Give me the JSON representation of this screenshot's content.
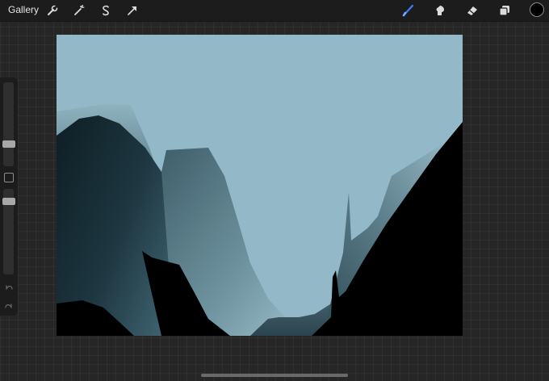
{
  "header": {
    "gallery_label": "Gallery",
    "left_tools": [
      "wrench-icon",
      "magic-wand-icon",
      "selection-icon",
      "transform-arrow-icon"
    ],
    "right_tools": [
      "brush-icon",
      "smudge-icon",
      "eraser-icon",
      "layers-icon"
    ],
    "active_tool": "brush",
    "accent_color": "#3b7ff0",
    "current_color": "#000000"
  },
  "canvas": {
    "sky_color": "#93b9c8",
    "foreground_color": "#000000",
    "haze_color": "#a7c6d2",
    "mountain_dark_color": "#14262d"
  },
  "sidebar": {
    "controls": [
      "brush-size-slider",
      "modify-button",
      "opacity-slider",
      "undo-icon",
      "redo-icon"
    ]
  }
}
